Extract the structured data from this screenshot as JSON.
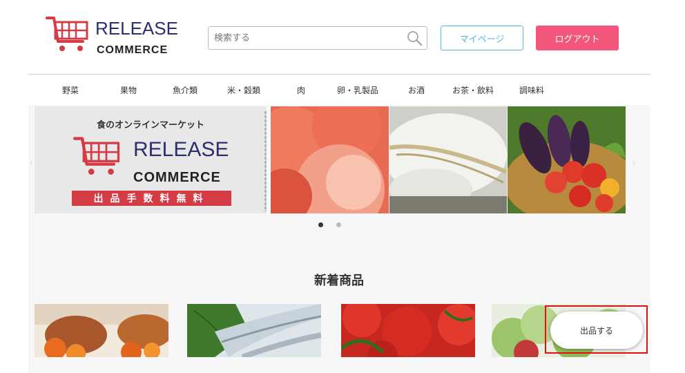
{
  "header": {
    "logo_top": "RELEASE",
    "logo_bottom": "COMMERCE",
    "search_placeholder": "検索する",
    "mypage_label": "マイページ",
    "logout_label": "ログアウト"
  },
  "nav": {
    "items": [
      "野菜",
      "果物",
      "魚介類",
      "米・穀類",
      "肉",
      "卵・乳製品",
      "お酒",
      "お茶・飲料",
      "調味料"
    ]
  },
  "hero": {
    "tagline": "食のオンラインマーケット",
    "logo_top": "RELEASE",
    "logo_bottom": "COMMERCE",
    "band": "出品手数料無料",
    "slides_total": 2,
    "active_slide": 1
  },
  "section": {
    "title": "新着商品"
  },
  "floating": {
    "sell_label": "出品する"
  },
  "colors": {
    "brand_navy": "#2a2f6e",
    "cart_red": "#d33b45",
    "mypage_blue": "#4fb7e3",
    "logout_pink": "#f2567a",
    "highlight_red": "#e01010"
  }
}
